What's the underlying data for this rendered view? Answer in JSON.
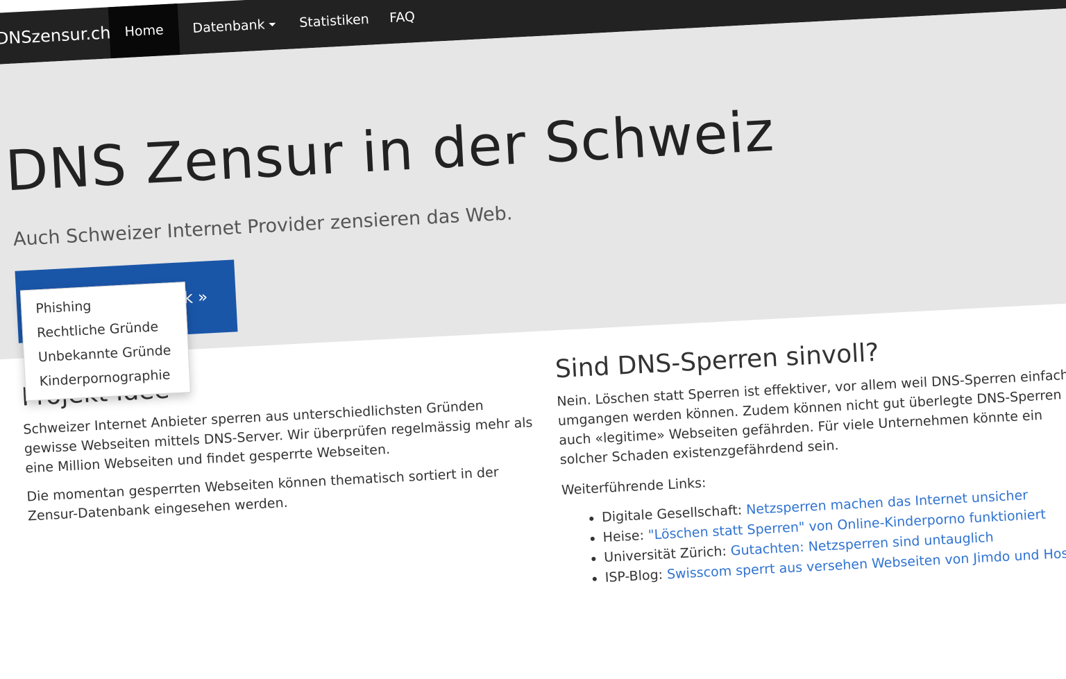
{
  "navbar": {
    "brand": "DNSzensur.ch",
    "items": [
      "Home",
      "Datenbank",
      "Statistiken",
      "FAQ"
    ]
  },
  "hero": {
    "title": "DNS Zensur in der Schweiz",
    "subtitle": "Auch Schweizer Internet Provider zensieren das Web.",
    "button_label": "Zensur-Datenbank »"
  },
  "dropdown": {
    "items": [
      "Phishing",
      "Rechtliche Gründe",
      "Unbekannte Gründe",
      "Kinderpornographie"
    ]
  },
  "project": {
    "heading": "Projekt Idee",
    "paragraphs": [
      "Schweizer Internet Anbieter sperren aus unterschiedlichsten Gründen gewisse Webseiten mittels DNS-Server. Wir überprüfen regelmässig mehr als eine Million Webseiten und findet gesperrte Webseiten.",
      "Die momentan gesperrten Webseiten können thematisch sortiert in der Zensur-Datenbank eingesehen werden."
    ]
  },
  "dns": {
    "heading": "Sind DNS-Sperren sinvoll?",
    "paragraph": "Nein. Löschen statt Sperren ist effektiver, vor allem weil DNS-Sperren einfach umgangen werden können. Zudem können nicht gut überlegte DNS-Sperren auch «legitime» Webseiten gefährden. Für viele Unternehmen könnte ein solcher Schaden existenzgefährdend sein.",
    "links_intro": "Weiterführende Links:",
    "links": [
      {
        "source": "Digitale Gesellschaft:",
        "title": "Netzsperren machen das Internet unsicher"
      },
      {
        "source": "Heise:",
        "title": "\"Löschen statt Sperren\" von Online-Kinderporno funktioniert"
      },
      {
        "source": "Universität Zürich:",
        "title": "Gutachten: Netzsperren sind untauglich"
      },
      {
        "source": "ISP-Blog:",
        "title": "Swisscom sperrt aus versehen Webseiten von Jimdo und Hostpoint"
      }
    ]
  }
}
